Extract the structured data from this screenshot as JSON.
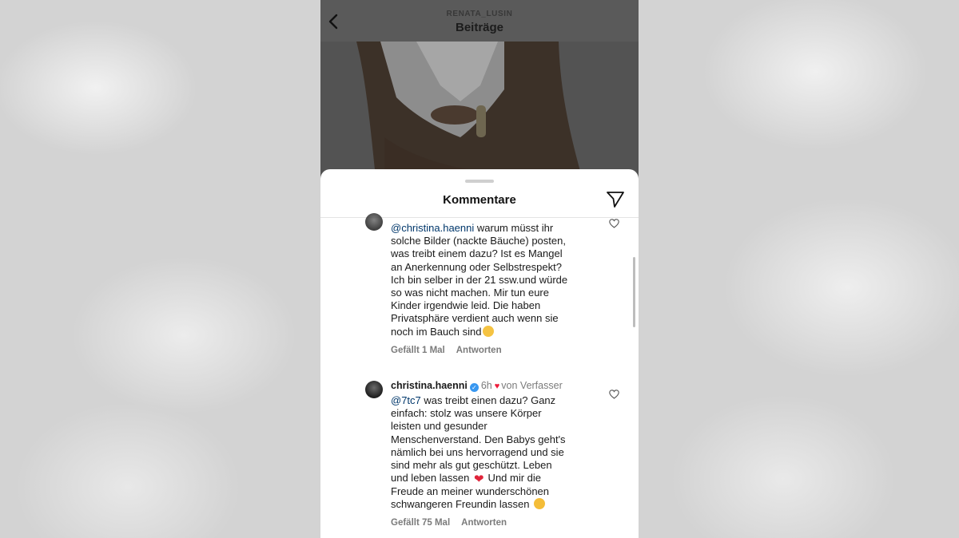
{
  "header": {
    "username": "RENATA_LUSIN",
    "title": "Beiträge"
  },
  "sheet": {
    "title": "Kommentare"
  },
  "comments": [
    {
      "mention": "@christina.haenni",
      "lines": [
        " warum müsst ihr",
        "solche Bilder (nackte Bäuche) posten,",
        "was treibt einem dazu? Ist es Mangel",
        "an Anerkennung oder Selbstrespekt?",
        "Ich bin selber in der 21 ssw.und würde",
        "so was nicht machen. Mir tun eure",
        "Kinder irgendwie leid. Die haben",
        "Privatsphäre verdient auch wenn sie",
        "noch im Bauch sind"
      ],
      "likes": "Gefällt 1 Mal",
      "reply": "Antworten"
    },
    {
      "username": "christina.haenni",
      "time": "6h",
      "author_tag": "von Verfasser",
      "mention": "@7tc7",
      "lines": [
        " was treibt einen dazu? Ganz",
        "einfach: stolz was unsere Körper",
        "leisten und gesunder",
        "Menschenverstand. Den Babys geht's",
        "nämlich bei uns hervorragend und sie",
        "sind mehr als gut geschützt. Leben",
        "und leben lassen",
        " Und mir die",
        "Freude an meiner wunderschönen",
        "schwangeren Freundin lassen"
      ],
      "likes": "Gefällt 75 Mal",
      "reply": "Antworten"
    }
  ],
  "icons": {
    "back": "chevron-left-icon",
    "send": "paper-plane-icon",
    "like": "heart-outline-icon",
    "verified": "verified-badge-icon"
  },
  "colors": {
    "mention": "#00376b",
    "author_heart": "#ed1c3a",
    "verified": "#3897f0"
  }
}
